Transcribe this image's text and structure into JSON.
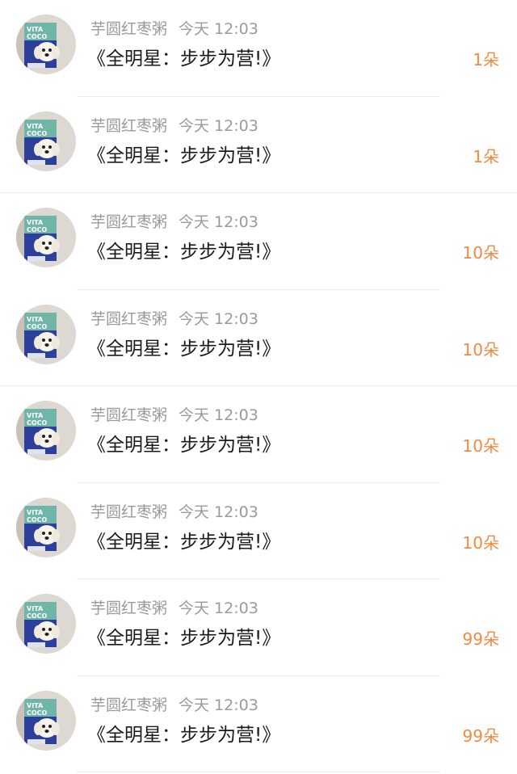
{
  "gifts": [
    {
      "username": "芋圆红枣粥",
      "time": "今天 12:03",
      "message": "《全明星：步步为营!》",
      "amount": "1朵",
      "avatar": "puppy-vita-coco-avatar"
    },
    {
      "username": "芋圆红枣粥",
      "time": "今天 12:03",
      "message": "《全明星：步步为营!》",
      "amount": "1朵",
      "avatar": "puppy-vita-coco-avatar"
    },
    {
      "username": "芋圆红枣粥",
      "time": "今天 12:03",
      "message": "《全明星：步步为营!》",
      "amount": "10朵",
      "avatar": "puppy-vita-coco-avatar"
    },
    {
      "username": "芋圆红枣粥",
      "time": "今天 12:03",
      "message": "《全明星：步步为营!》",
      "amount": "10朵",
      "avatar": "puppy-vita-coco-avatar"
    },
    {
      "username": "芋圆红枣粥",
      "time": "今天 12:03",
      "message": "《全明星：步步为营!》",
      "amount": "10朵",
      "avatar": "puppy-vita-coco-avatar"
    },
    {
      "username": "芋圆红枣粥",
      "time": "今天 12:03",
      "message": "《全明星：步步为营!》",
      "amount": "10朵",
      "avatar": "puppy-vita-coco-avatar"
    },
    {
      "username": "芋圆红枣粥",
      "time": "今天 12:03",
      "message": "《全明星：步步为营!》",
      "amount": "99朵",
      "avatar": "puppy-vita-coco-avatar"
    },
    {
      "username": "芋圆红枣粥",
      "time": "今天 12:03",
      "message": "《全明星：步步为营!》",
      "amount": "99朵",
      "avatar": "puppy-vita-coco-avatar"
    }
  ],
  "avatar_logo_text": "VITA COCO",
  "colors": {
    "amount": "#ef8a3f",
    "meta": "#9a9a9a",
    "message": "#1a1a1a",
    "divider": "#ececec"
  }
}
